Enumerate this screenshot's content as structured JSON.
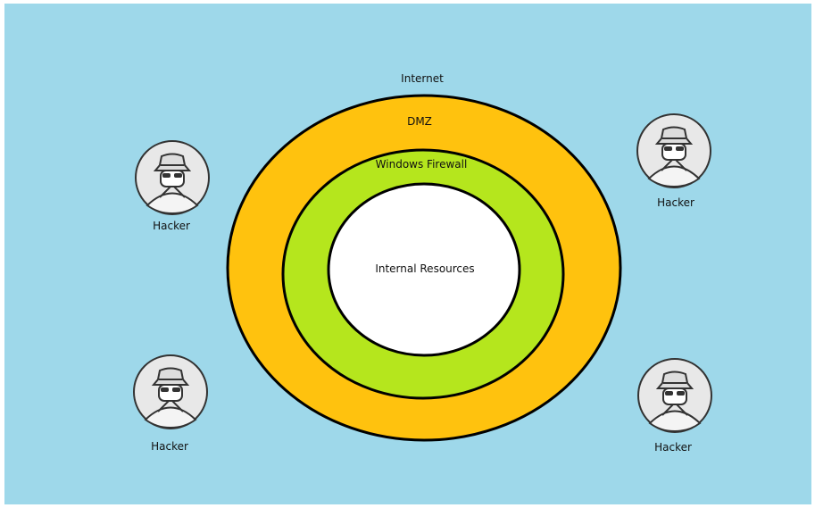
{
  "zones": {
    "internet": "Internet",
    "dmz": "DMZ",
    "firewall": "Windows Firewall",
    "internal": "Internal Resources"
  },
  "hackers": [
    {
      "label": "Hacker"
    },
    {
      "label": "Hacker"
    },
    {
      "label": "Hacker"
    },
    {
      "label": "Hacker"
    }
  ],
  "colors": {
    "background": "#9ED8EA",
    "dmz": "#FFC20E",
    "firewall": "#B5E61D",
    "internal": "#FFFFFF",
    "outline": "#000000"
  }
}
